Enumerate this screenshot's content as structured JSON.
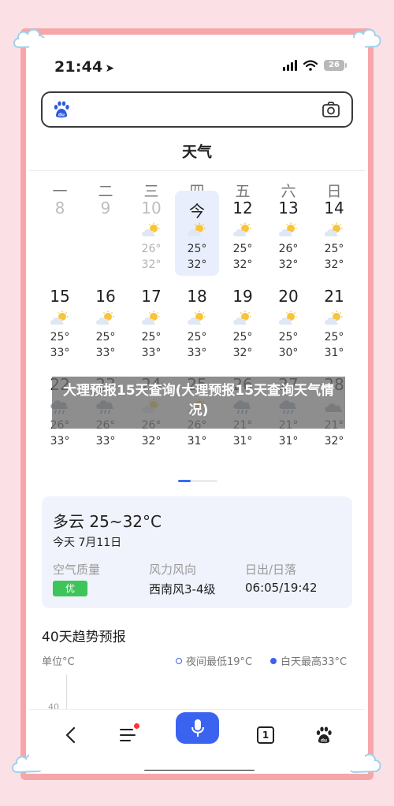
{
  "status_bar": {
    "time": "21:44",
    "location_arrow": "➤",
    "battery": "26"
  },
  "search": {
    "placeholder": ""
  },
  "page_title": "天气",
  "weekdays": [
    "一",
    "二",
    "三",
    "四",
    "五",
    "六",
    "日"
  ],
  "calendar": {
    "rows": [
      [
        {
          "day": "8",
          "past": true,
          "lo": "",
          "hi": "",
          "icon": "none"
        },
        {
          "day": "9",
          "past": true,
          "lo": "",
          "hi": "",
          "icon": "none"
        },
        {
          "day": "10",
          "past": true,
          "lo": "26°",
          "hi": "32°",
          "icon": "sun-cloud-icon"
        },
        {
          "day": "今",
          "today": true,
          "lo": "25°",
          "hi": "32°",
          "icon": "sun-cloud-icon"
        },
        {
          "day": "12",
          "lo": "25°",
          "hi": "32°",
          "icon": "sun-cloud-icon"
        },
        {
          "day": "13",
          "lo": "26°",
          "hi": "32°",
          "icon": "sun-cloud-icon"
        },
        {
          "day": "14",
          "lo": "25°",
          "hi": "32°",
          "icon": "sun-cloud-icon"
        }
      ],
      [
        {
          "day": "15",
          "lo": "25°",
          "hi": "33°",
          "icon": "sun-cloud-icon"
        },
        {
          "day": "16",
          "lo": "25°",
          "hi": "33°",
          "icon": "sun-cloud-icon"
        },
        {
          "day": "17",
          "lo": "25°",
          "hi": "33°",
          "icon": "sun-cloud-icon"
        },
        {
          "day": "18",
          "lo": "25°",
          "hi": "33°",
          "icon": "sun-cloud-icon"
        },
        {
          "day": "19",
          "lo": "25°",
          "hi": "32°",
          "icon": "sun-cloud-icon"
        },
        {
          "day": "20",
          "lo": "25°",
          "hi": "30°",
          "icon": "sun-cloud-icon"
        },
        {
          "day": "21",
          "lo": "25°",
          "hi": "31°",
          "icon": "sun-cloud-icon"
        }
      ],
      [
        {
          "day": "22",
          "lo": "26°",
          "hi": "33°",
          "icon": "cloud-rain-icon"
        },
        {
          "day": "23",
          "lo": "26°",
          "hi": "33°",
          "icon": "cloud-rain-icon"
        },
        {
          "day": "24",
          "lo": "26°",
          "hi": "32°",
          "icon": "sun-cloud-icon"
        },
        {
          "day": "25",
          "lo": "26°",
          "hi": "31°",
          "icon": "sun-cloud-icon"
        },
        {
          "day": "26",
          "lo": "21°",
          "hi": "31°",
          "icon": "cloud-rain-icon"
        },
        {
          "day": "27",
          "lo": "21°",
          "hi": "31°",
          "icon": "cloud-rain-icon"
        },
        {
          "day": "28",
          "lo": "21°",
          "hi": "32°",
          "icon": "cloud-icon"
        }
      ]
    ]
  },
  "today_card": {
    "summary": "多云 25~32°C",
    "date": "今天 7月11日",
    "air_quality_label": "空气质量",
    "air_quality_value": "优",
    "wind_label": "风力风向",
    "wind_value": "西南风3-4级",
    "sun_label": "日出/日落",
    "sun_value": "06:05/19:42"
  },
  "trend": {
    "title": "40天趋势预报",
    "unit": "单位°C",
    "legend_night": "夜间最低19°C",
    "legend_day": "白天最高33°C",
    "tick": "40"
  },
  "bottom_nav": {
    "tab_count": "1"
  },
  "caption": "大理预报15天查询(大理预报15天查询天气情况)",
  "colors": {
    "accent": "#3a63ef",
    "aqi_good": "#3ec55a",
    "frame": "#f6a6a9",
    "background": "#fbe1e6"
  }
}
